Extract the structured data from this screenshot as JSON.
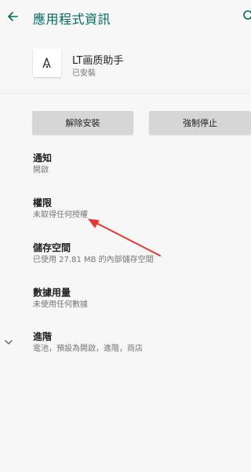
{
  "header": {
    "title": "應用程式資訊",
    "back_icon": "arrow-left-icon",
    "search_icon": "search-icon"
  },
  "app": {
    "name": "LT画质助手",
    "status": "已安裝",
    "icon": "app-logo-icon"
  },
  "actions": {
    "uninstall_label": "解除安裝",
    "force_stop_label": "強制停止"
  },
  "settings": [
    {
      "title": "通知",
      "subtitle": "開啟"
    },
    {
      "title": "權限",
      "subtitle": "未取得任何授權"
    },
    {
      "title": "儲存空間",
      "subtitle": "已使用 27.81 MB 的內部儲存空間"
    },
    {
      "title": "數據用量",
      "subtitle": "未使用任何數據"
    },
    {
      "title": "進階",
      "subtitle": "電池，預設為開啟，進階，商店"
    }
  ],
  "colors": {
    "accent": "#00695c",
    "annotation_arrow": "#e53935"
  }
}
